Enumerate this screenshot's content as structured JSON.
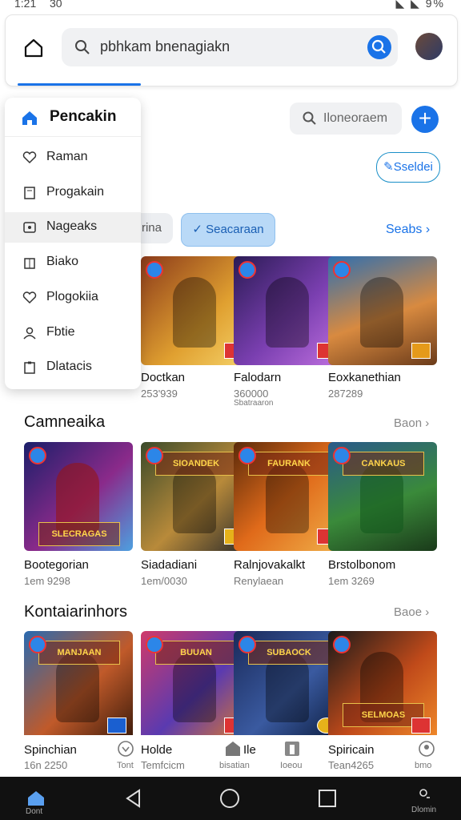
{
  "status": {
    "time": "1:21",
    "batt": "30",
    "signal": "◣ ◣ 9%"
  },
  "search": {
    "query": "pbhkam bnenagiakn"
  },
  "menu": {
    "header": "Pencakin",
    "items": [
      {
        "label": "Raman",
        "icon": "heart-icon"
      },
      {
        "label": "Progakain",
        "icon": "doc-icon"
      },
      {
        "label": "Nageaks",
        "icon": "game-icon"
      },
      {
        "label": "Biako",
        "icon": "box-icon"
      },
      {
        "label": "Plogokiia",
        "icon": "heart-icon"
      },
      {
        "label": "Fbtie",
        "icon": "user-icon"
      },
      {
        "label": "Dlatacis",
        "icon": "clip-icon"
      }
    ]
  },
  "toolbar": {
    "sub_search": "Iloneoraem",
    "edit": "Sseldei"
  },
  "chips": {
    "chip1": "irina",
    "chip2": "Seacaraan"
  },
  "top_row": {
    "see": "Seabs",
    "items": [
      {
        "title": "Doctkan",
        "sub": "253'939"
      },
      {
        "title": "Falodarn",
        "sub": "360000",
        "sub2": "Sbatraaron"
      },
      {
        "title": "Eoxkanethian",
        "sub": "287289"
      }
    ]
  },
  "section1": {
    "title": "Camneaika",
    "see": "Baon",
    "items": [
      {
        "title": "Bootegorian",
        "sub": "1em 9298",
        "banner": "SLECRAGAS"
      },
      {
        "title": "Siadadiani",
        "sub": "1em/0030",
        "banner": "SIOANDEK"
      },
      {
        "title": "Ralnjovakalkt",
        "sub": "Renylaean",
        "banner": "FAURANK"
      },
      {
        "title": "Brstolbonom",
        "sub": "1em 3269",
        "banner": "CANKAUS"
      }
    ]
  },
  "section2": {
    "title": "Kontaiarinhors",
    "see": "Baoe",
    "items": [
      {
        "title": "Spinchian",
        "sub": "16n 2250",
        "banner": "MANJAAN"
      },
      {
        "title": "Holde",
        "sub": "Temfcicm",
        "banner": "BUUAN"
      },
      {
        "title": "Ile",
        "sub": "bisatian",
        "banner": "SUBAOCK"
      },
      {
        "title": "Spiricain",
        "sub": "Tean4265",
        "banner": "SELMOAS"
      }
    ]
  },
  "bottom_nav": {
    "b1": "Tont",
    "b2": "Ioeou",
    "b3": "bmo"
  },
  "sysbar": {
    "left": "Dont",
    "right": "Dlomin"
  }
}
